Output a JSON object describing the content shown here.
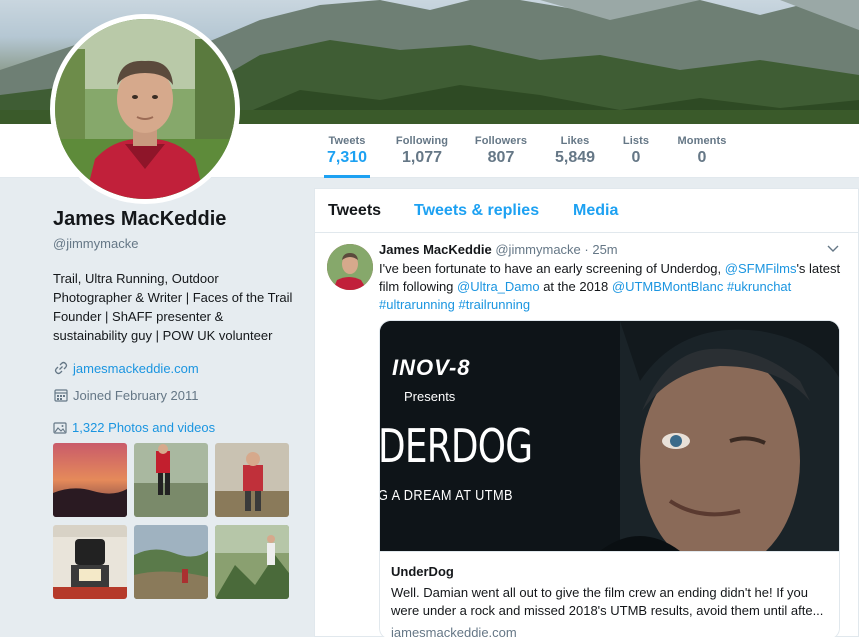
{
  "stats": [
    {
      "label": "Tweets",
      "value": "7,310",
      "active": true
    },
    {
      "label": "Following",
      "value": "1,077"
    },
    {
      "label": "Followers",
      "value": "807"
    },
    {
      "label": "Likes",
      "value": "5,849"
    },
    {
      "label": "Lists",
      "value": "0"
    },
    {
      "label": "Moments",
      "value": "0"
    }
  ],
  "profile": {
    "name": "James MacKeddie",
    "handle": "@jimmymacke",
    "bio": "Trail, Ultra Running, Outdoor Photographer & Writer | Faces of the Trail Founder | ShAFF presenter & sustainability guy | POW UK volunteer",
    "website": "jamesmackeddie.com",
    "joined": "Joined February 2011",
    "photos_link": "1,322 Photos and videos"
  },
  "tabs": [
    "Tweets",
    "Tweets & replies",
    "Media"
  ],
  "tweet": {
    "name": "James MacKeddie",
    "handle": "@jimmymacke",
    "time": "· 25m",
    "text_1": "I've been fortunate to have an early screening of Underdog, ",
    "mention_1": "@SFMFilms",
    "text_2": "'s latest film following ",
    "mention_2": "@Ultra_Damo",
    "text_3": " at the 2018 ",
    "mention_3": "@UTMBMontBlanc",
    "text_4": " ",
    "hashtag_1": "#ukrunchat",
    "hashtag_2": "#ultrarunning",
    "hashtag_3": "#trailrunning",
    "card": {
      "brand": "INOV-8",
      "presents": "Presents",
      "film_title": "DERDOG",
      "film_subtitle": "G A DREAM AT UTMB",
      "title": "UnderDog",
      "description": "Well. Damian went all out to give the film crew an ending didn't he! If you were under a rock and missed 2018's UTMB results, avoid them until afte...",
      "domain": "jamesmackeddie.com"
    }
  },
  "colors": {
    "accent": "#1da1f2",
    "link": "#1b95e0",
    "secondary_text": "#657786",
    "background": "#e6ecf0"
  },
  "icons": {
    "website": "link-icon",
    "joined": "calendar-icon",
    "photos": "image-icon",
    "caret": "chevron-down-icon"
  }
}
